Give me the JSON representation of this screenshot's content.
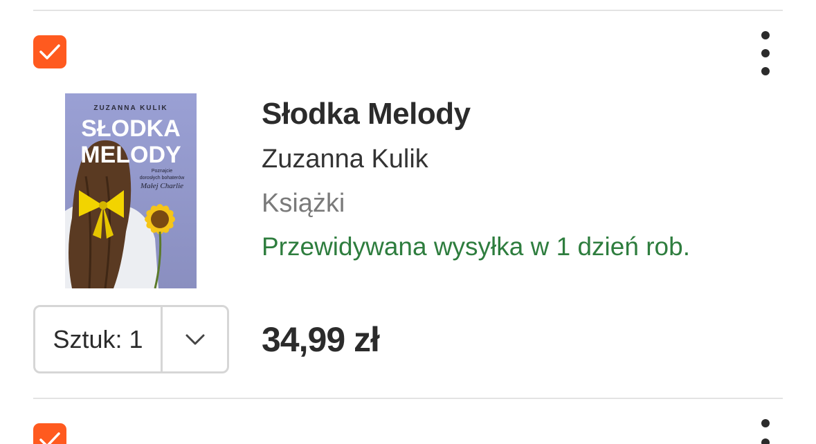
{
  "colors": {
    "accent": "#ff5a1f",
    "shipping_green": "#2e7d3e",
    "text": "#2b2b2b",
    "muted": "#7a7a7a",
    "border": "#d6d6d6"
  },
  "cart_items": [
    {
      "selected": true,
      "cover": {
        "author_text": "ZUZANNA KULIK",
        "title_line1": "SŁODKA",
        "title_line2": "MELODY",
        "tagline_line1": "Poznajcie",
        "tagline_line2": "dorosłych bohaterów",
        "tagline_line3": "Małej Charlie"
      },
      "title": "Słodka Melody",
      "author": "Zuzanna Kulik",
      "category": "Książki",
      "shipping": "Przewidywana wysyłka w 1 dzień rob.",
      "quantity_label": "Sztuk: 1",
      "price": "34,99 zł"
    },
    {
      "selected": true
    }
  ],
  "icons": {
    "checkbox": "check-icon",
    "menu": "more-vertical-icon",
    "dropdown": "chevron-down-icon"
  }
}
